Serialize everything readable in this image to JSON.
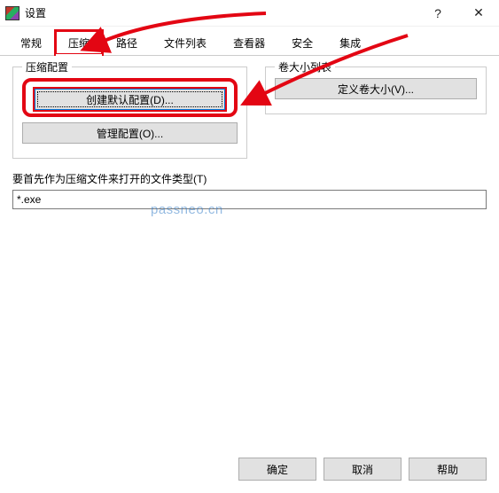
{
  "window": {
    "title": "设置"
  },
  "tabs": {
    "general": "常规",
    "compression": "压缩",
    "paths": "路径",
    "filelist": "文件列表",
    "viewer": "查看器",
    "security": "安全",
    "integration": "集成"
  },
  "groups": {
    "compress_config_legend": "压缩配置",
    "volume_list_legend": "卷大小列表"
  },
  "buttons": {
    "create_default_config": "创建默认配置(D)...",
    "manage_config": "管理配置(O)...",
    "define_volumes": "定义卷大小(V)...",
    "ok": "确定",
    "cancel": "取消",
    "help": "帮助"
  },
  "labels": {
    "filetype_label": "要首先作为压缩文件来打开的文件类型(T)"
  },
  "inputs": {
    "filetype_value": "*.exe"
  },
  "watermark": "passneo.cn"
}
